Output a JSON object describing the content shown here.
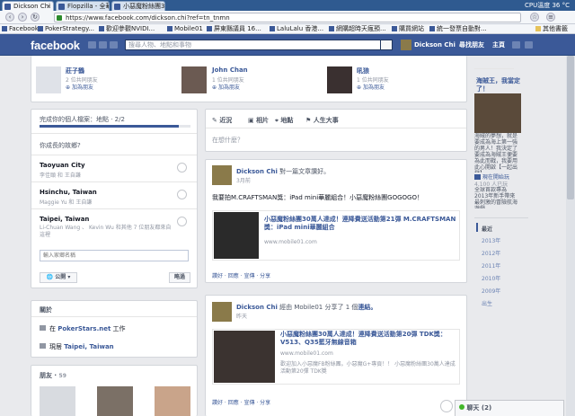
{
  "browser": {
    "tabs": [
      {
        "label": "Dickson Chi",
        "active": true
      },
      {
        "label": "Flopzilla - 全華首映..."
      },
      {
        "label": "小惡魔粉絲團30萬人..."
      }
    ],
    "tray": "CPU溫度 36 °C",
    "url": "https://www.facebook.com/dickson.chi?ref=tn_tnmn",
    "bookmarks": [
      "Facebook",
      "PokerStrategy...",
      "歡迎參觀NVIDI...",
      "Mobile01",
      "屏東縣議員 16...",
      "LaluLalu 香港...",
      "網購超時天瘋預...",
      "購買網站",
      "統一發票自動對...",
      "其他書籤"
    ]
  },
  "fb": {
    "logo": "facebook",
    "search_placeholder": "搜尋人物、地點和事物",
    "profile_name": "Dickson Chi",
    "find_friends": "尋找朋友",
    "home": "主頁"
  },
  "friend_suggestions": [
    {
      "name": "莊子鶴",
      "mutual": "2 位共同朋友",
      "add": "加為朋友"
    },
    {
      "name": "John Chan",
      "mutual": "1 位共同朋友",
      "add": "加為朋友"
    },
    {
      "name": "吼狼",
      "mutual": "1 位共同朋友",
      "add": "加為朋友"
    }
  ],
  "profile_complete": {
    "title": "完成你的個人檔案：地點 · 2/2",
    "progress": 0.92,
    "question": "你成長的故鄉?",
    "options": [
      {
        "city": "Taoyuan City",
        "who": "李佳頤 和 王自謙"
      },
      {
        "city": "Hsinchu, Taiwan",
        "who": "Maggie Yu 和 王自謙"
      },
      {
        "city": "Taipei, Taiwan",
        "who": "Li-Chuan Wang 、 Kevin Wu 和其他 7 位朋友都來自這裡"
      }
    ],
    "input_placeholder": "輸入家鄉名稱",
    "privacy": "公開",
    "skip": "略過"
  },
  "about": {
    "title": "關於",
    "work_prefix": "在 ",
    "work_place": "PokerStars.net",
    "work_suffix": " 工作",
    "live_prefix": "現居 ",
    "live_place": "Taipei, Taiwan"
  },
  "friends": {
    "title": "朋友",
    "count": "59"
  },
  "composer": {
    "tabs": [
      "近況",
      "相片",
      "地點",
      "人生大事"
    ],
    "placeholder": "在想什麼？"
  },
  "post1": {
    "author": "Dickson Chi",
    "action": "對一篇文章讚好。",
    "time": "3月前",
    "text": "我要拍M.CRAFTSMAN獎：iPad mini華麗組合！小惡魔粉絲團GOGOGO！",
    "link_title": "小惡魔粉絲團30萬人達成！連降費送活動第21彈 M.CRAFTSMAN獎：iPad mini華麗組合",
    "link_domain": "www.mobile01.com",
    "actions": "讚好 · 回應 · 宣傳 · 分享"
  },
  "post2": {
    "author": "Dickson Chi",
    "action_pre": "經由 Mobile01 分享了 1 個",
    "action_link": "連結。",
    "time": "昨天",
    "link_title": "小惡魔粉絲團30萬人達成！連降費送活動第20彈 TDK獎：V513、Q35藍牙無線音箱",
    "link_domain": "www.mobile01.com",
    "link_desc": "歡迎加入小惡魔FB粉絲團。小惡魔G+專頁！！ 小惡魔粉絲團30萬人達成活動第20彈 TDK獎",
    "actions": "讚好 · 回應 · 宣傳 · 分享"
  },
  "sidebar": {
    "ticker": "海賊王，我當定了！",
    "ticker_sub": "海賊的夢想，就是要成為海上第一強的男人！我決定了要成為海賊王便要為此而戰，我要用此心開啟【一起出發】",
    "like_page": "現在開始玩",
    "like_count": "4,100 人已玩",
    "ad_desc": "全球首款專為2013年新手帶來最刺激的冒險航海遊戲",
    "timeline_top": "最近",
    "years": [
      "2013年",
      "2012年",
      "2011年",
      "2010年",
      "2009年",
      "出生"
    ]
  },
  "chat": {
    "label": "聊天 (2)"
  }
}
